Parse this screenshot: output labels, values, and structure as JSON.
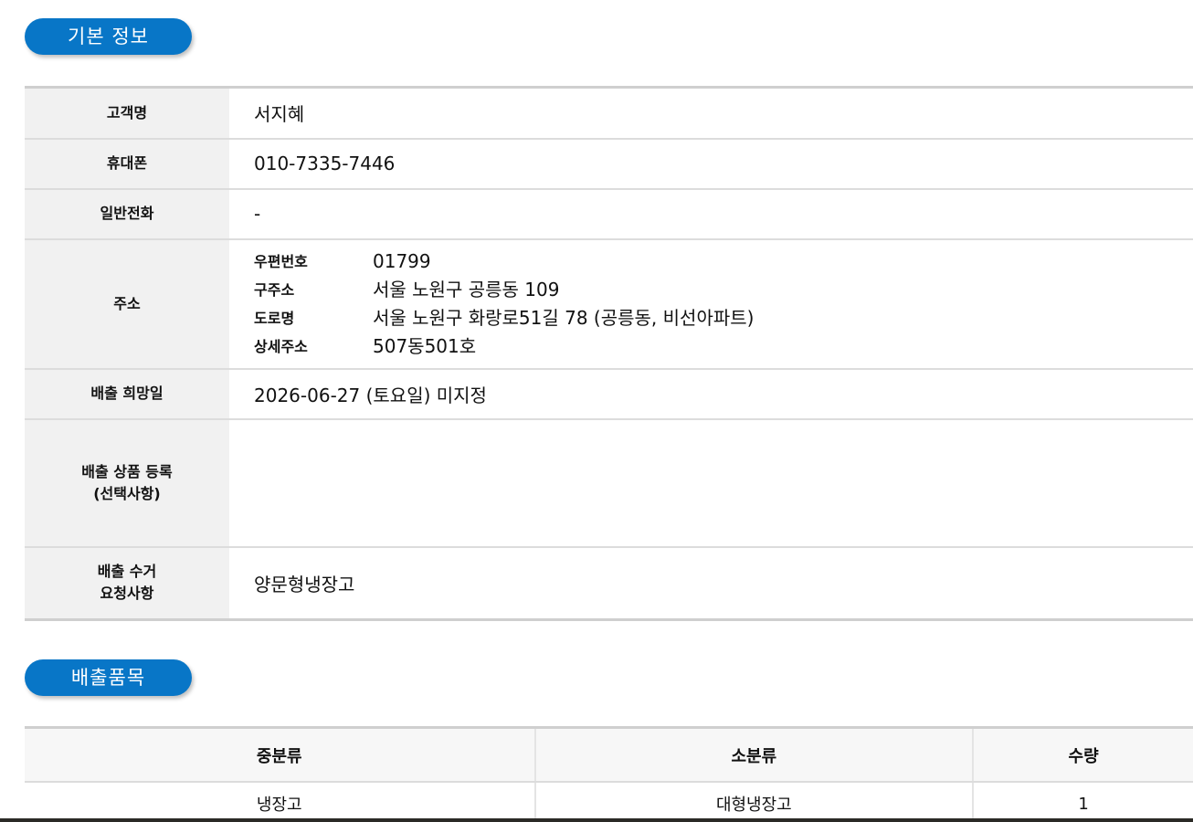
{
  "sections": {
    "basic_info": "기본 정보",
    "items": "배출품목"
  },
  "info": {
    "name_label": "고객명",
    "name_value": "서지혜",
    "mobile_label": "휴대폰",
    "mobile_value": "010-7335-7446",
    "tel_label": "일반전화",
    "tel_value": "-",
    "address_label": "주소",
    "address": {
      "zip_label": "우편번호",
      "zip_value": "01799",
      "old_label": "구주소",
      "old_value": "서울 노원구 공릉동 109",
      "road_label": "도로명",
      "road_value": "서울 노원구 화랑로51길 78 (공릉동, 비선아파트)",
      "detail_label": "상세주소",
      "detail_value": "507동501호"
    },
    "date_label": "배출 희망일",
    "date_value": "2026-06-27 (토요일) 미지정",
    "product_label_line1": "배출 상품 등록",
    "product_label_line2": "(선택사항)",
    "product_value": "",
    "request_label_line1": "배출 수거",
    "request_label_line2": "요청사항",
    "request_value": "양문형냉장고"
  },
  "items_table": {
    "headers": [
      "중분류",
      "소분류",
      "수량"
    ],
    "rows": [
      [
        "냉장고",
        "대형냉장고",
        "1"
      ]
    ]
  }
}
